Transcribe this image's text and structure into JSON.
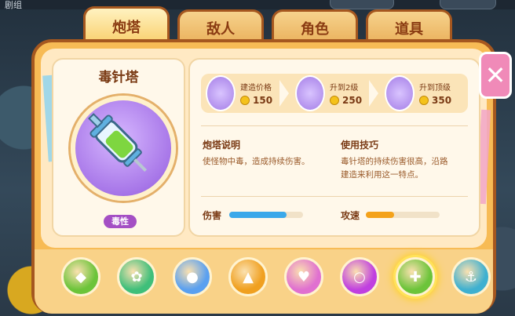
{
  "top": {
    "corner_label": "剧组"
  },
  "tabs": [
    {
      "label": "炮塔",
      "active": true
    },
    {
      "label": "敌人",
      "active": false
    },
    {
      "label": "角色",
      "active": false
    },
    {
      "label": "道具",
      "active": false
    }
  ],
  "tower": {
    "name": "毒针塔",
    "tag": "毒性",
    "icon": "poison-syringe-icon"
  },
  "upgrades": [
    {
      "label": "建造价格",
      "cost": "150",
      "icon": "syringe-level1-icon"
    },
    {
      "label": "升到2级",
      "cost": "250",
      "icon": "syringe-level2-icon"
    },
    {
      "label": "升到顶级",
      "cost": "350",
      "icon": "syringe-max-icon"
    }
  ],
  "description": {
    "title": "炮塔说明",
    "text": "使怪物中毒，造成持续伤害。"
  },
  "tips": {
    "title": "使用技巧",
    "text_line1": "毒针塔的持续伤害很高，沿路",
    "text_line2": "建造来利用这一特点。"
  },
  "stats": [
    {
      "label": "伤害",
      "level": 0.78,
      "color": "#3aa8ea"
    },
    {
      "label": "攻速",
      "level": 0.38,
      "color": "#f4a21a"
    }
  ],
  "close_icon": "close-x-icon",
  "tower_list": [
    {
      "icon": "bottle-tower-icon",
      "color": "#6cc43a"
    },
    {
      "icon": "fan-tower-icon",
      "color": "#3fbf7a"
    },
    {
      "icon": "ball-tower-icon",
      "color": "#5aa0f0"
    },
    {
      "icon": "rocket-tower-icon",
      "color": "#f0a020"
    },
    {
      "icon": "love-bottle-tower-icon",
      "color": "#e070d0"
    },
    {
      "icon": "bubble-tower-icon",
      "color": "#c040e0"
    },
    {
      "icon": "poison-syringe-icon",
      "color": "#6cc43a",
      "selected": true
    },
    {
      "icon": "anchor-tower-icon",
      "color": "#3fb0d0"
    }
  ]
}
